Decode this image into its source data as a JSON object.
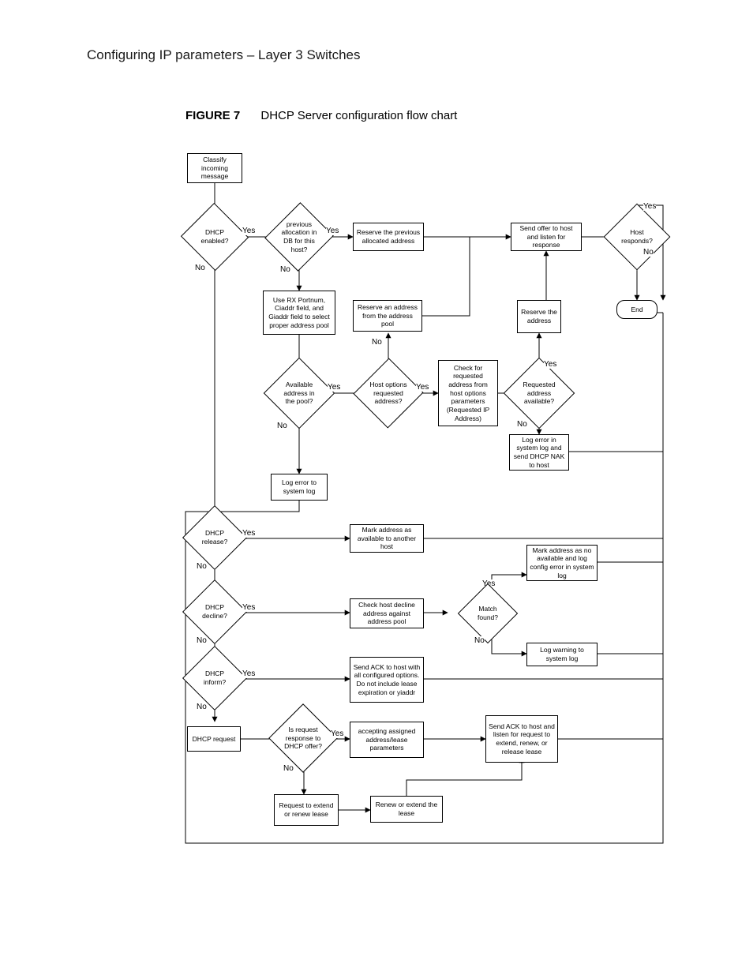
{
  "page": {
    "header": "Configuring IP parameters – Layer 3 Switches",
    "figure_label": "FIGURE 7",
    "figure_title": "DHCP Server configuration flow chart"
  },
  "nodes": {
    "classify": "Classify incoming message",
    "dhcp_enabled": "DHCP enabled?",
    "prev_alloc": "previous allocation in DB for this host?",
    "reserve_prev": "Reserve the previous allocated address",
    "send_offer": "Send offer to host and listen for response",
    "host_responds": "Host responds?",
    "end": "End",
    "use_rx": "Use RX Portnum, Ciaddr field, and Giaddr field to select proper address pool",
    "reserve_pool": "Reserve an address from the address pool",
    "reserve_addr": "Reserve the address",
    "avail_pool": "Available address in the pool?",
    "host_opts": "Host options requested address?",
    "check_req": "Check for requested address from host options parameters (Requested IP Address)",
    "req_avail": "Requested address available?",
    "log_nak": "Log error in system log and send DHCP NAK to host",
    "log_err": "Log error to system log",
    "dhcp_release": "DHCP release?",
    "mark_avail": "Mark address as available to another host",
    "mark_noavail": "Mark address as no available and log config error in system log",
    "dhcp_decline": "DHCP decline?",
    "check_decline": "Check host decline address against address pool",
    "match_found": "Match found?",
    "log_warn": "Log warning to system log",
    "dhcp_inform": "DHCP inform?",
    "send_ack_inform": "Send ACK to host with all configured options. Do not include lease expiration or yiaddr",
    "dhcp_request": "DHCP request",
    "is_resp": "Is request response to DHCP offer?",
    "accepting": "accepting assigned address/lease parameters",
    "send_ack_listen": "Send ACK to host and listen for request to extend, renew, or release lease",
    "req_extend": "Request to extend or renew lease",
    "renew_extend": "Renew or extend the lease"
  },
  "labels": {
    "yes": "Yes",
    "no": "No"
  }
}
